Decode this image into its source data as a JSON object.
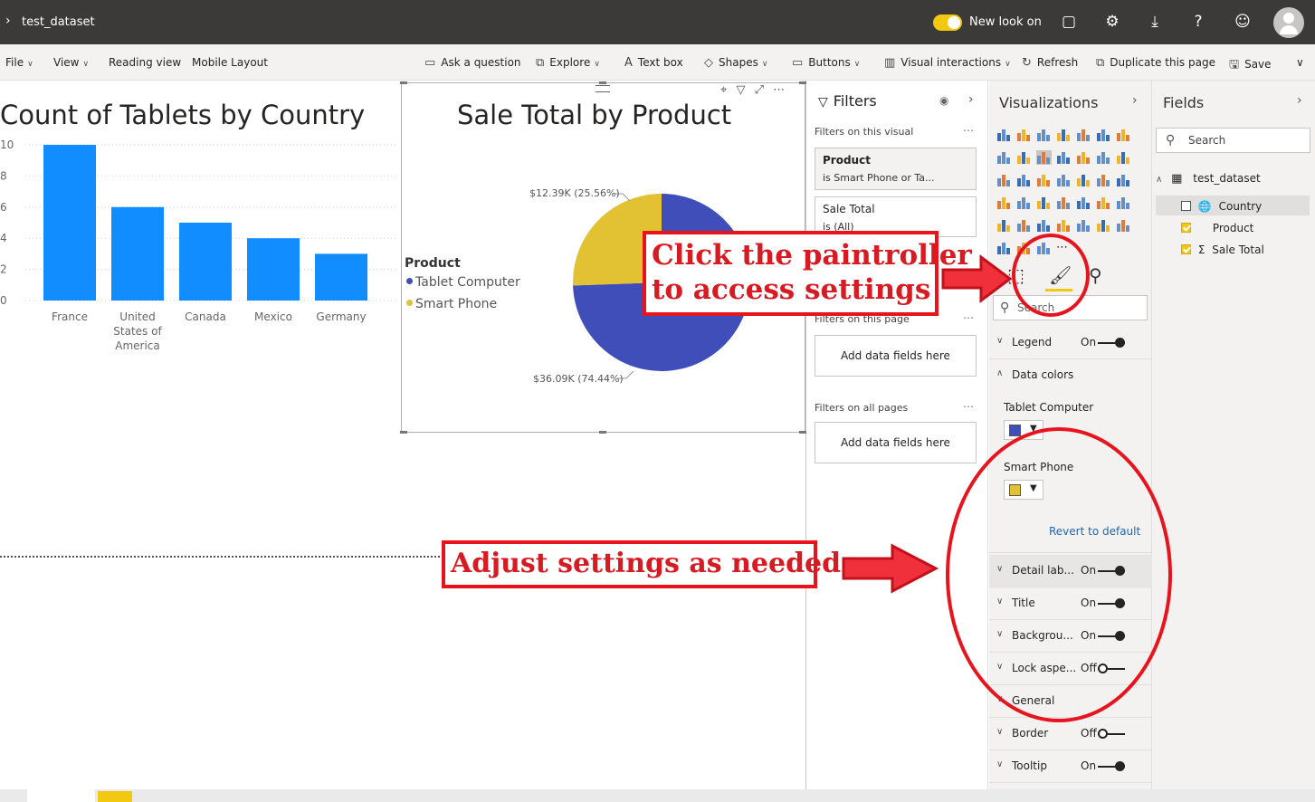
{
  "titlebar": {
    "title": "test_dataset",
    "new_look_label": "New look on"
  },
  "ribbon": {
    "left_menus": [
      "File",
      "View",
      "Reading view",
      "Mobile Layout"
    ],
    "ask_question": "Ask a question",
    "explore": "Explore",
    "text_box": "Text box",
    "shapes": "Shapes",
    "buttons": "Buttons",
    "visual_interactions": "Visual interactions",
    "refresh": "Refresh",
    "duplicate_page": "Duplicate this page",
    "save": "Save"
  },
  "bar_chart": {
    "title": "Count of Tablets by Country",
    "y_ticks": [
      "10",
      "8",
      "6",
      "4",
      "2",
      "0"
    ],
    "categories": [
      "France",
      "United States of America",
      "Canada",
      "Mexico",
      "Germany"
    ],
    "category_lines": [
      [
        "France"
      ],
      [
        "United",
        "States of",
        "America"
      ],
      [
        "Canada"
      ],
      [
        "Mexico"
      ],
      [
        "Germany"
      ]
    ]
  },
  "pie_chart": {
    "title": "Sale Total by Product",
    "legend_title": "Product",
    "legend": [
      "Tablet Computer",
      "Smart Phone"
    ],
    "label_smart_phone": "$12.39K (25.56%)",
    "label_tablet": "$36.09K (74.44%)"
  },
  "chart_data": [
    {
      "type": "bar",
      "title": "Count of Tablets by Country",
      "categories": [
        "France",
        "United States of America",
        "Canada",
        "Mexico",
        "Germany"
      ],
      "values": [
        10,
        6,
        5,
        4,
        3
      ],
      "ylim": [
        0,
        10
      ],
      "color": "#118dff"
    },
    {
      "type": "pie",
      "title": "Sale Total by Product",
      "legend_title": "Product",
      "categories": [
        "Tablet Computer",
        "Smart Phone"
      ],
      "values": [
        36.09,
        12.39
      ],
      "percents": [
        74.44,
        25.56
      ],
      "colors": [
        "#3f4eb8",
        "#e2c232"
      ]
    }
  ],
  "filters": {
    "header": "Filters",
    "on_visual": "Filters on this visual",
    "card1_title": "Product",
    "card1_sub": "is Smart Phone or Ta...",
    "card2_title": "Sale Total",
    "card2_sub": "is (All)",
    "on_page": "Filters on this page",
    "on_all_pages": "Filters on all pages",
    "add_fields": "Add data fields here"
  },
  "visualizations": {
    "header": "Visualizations",
    "search_placeholder": "Search",
    "settings": [
      {
        "label": "Legend",
        "state": "On"
      },
      {
        "label": "Data colors",
        "state": ""
      },
      {
        "label": "Detail lab...",
        "state": "On"
      },
      {
        "label": "Title",
        "state": "On"
      },
      {
        "label": "Backgrou...",
        "state": "On"
      },
      {
        "label": "Lock aspe...",
        "state": "Off"
      },
      {
        "label": "General",
        "state": ""
      },
      {
        "label": "Border",
        "state": "Off"
      },
      {
        "label": "Tooltip",
        "state": "On"
      }
    ],
    "data_colors": [
      {
        "label": "Tablet Computer",
        "color": "#3f4eb8"
      },
      {
        "label": "Smart Phone",
        "color": "#e2c232"
      }
    ],
    "revert": "Revert to default"
  },
  "fields": {
    "header": "Fields",
    "search": "Search",
    "table": "test_dataset",
    "items": [
      {
        "label": "Country",
        "checked": false
      },
      {
        "label": "Product",
        "checked": true
      },
      {
        "label": "Sale Total",
        "checked": true
      }
    ]
  },
  "annotations": {
    "paintroller_line1": "Click the paintroller",
    "paintroller_line2": "to access settings",
    "adjust": "Adjust settings as needed"
  }
}
